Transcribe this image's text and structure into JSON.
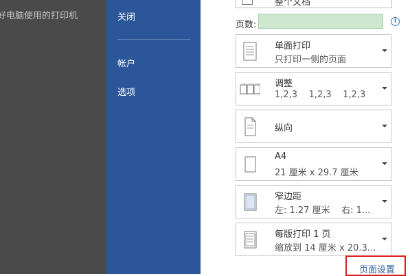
{
  "background_doc": {
    "line1": "好电脑使用的打印机",
    "line2": "]"
  },
  "sidebar": {
    "items": [
      {
        "label": "关闭"
      },
      {
        "label": "帐户"
      },
      {
        "label": "选项"
      }
    ]
  },
  "settings": {
    "top_partial": "整个文档",
    "pages_label": "页数:",
    "pages_value": "",
    "dropdowns": [
      {
        "title": "单面打印",
        "subtitle": "只打印一侧的页面",
        "icon": "single-sided-icon"
      },
      {
        "title": "调整",
        "subtitle": "1,2,3    1,2,3    1,2,3",
        "icon": "collated-icon"
      },
      {
        "title": "纵向",
        "subtitle": "",
        "icon": "portrait-icon"
      },
      {
        "title": "A4",
        "subtitle": "21 厘米 x 29.7 厘米",
        "icon": "paper-size-icon"
      },
      {
        "title": "窄边距",
        "subtitle": "左: 1.27 厘米    右: 1...",
        "icon": "margins-icon"
      },
      {
        "title": "每版打印 1 页",
        "subtitle": "缩放到 14 厘米 x 20.3...",
        "icon": "pages-per-sheet-icon"
      }
    ],
    "page_setup_link": "页面设置"
  },
  "colors": {
    "sidebar": "#2b579a",
    "pages_input": "#cde8cf",
    "highlight": "#d9201e",
    "link": "#2e5f9e"
  }
}
